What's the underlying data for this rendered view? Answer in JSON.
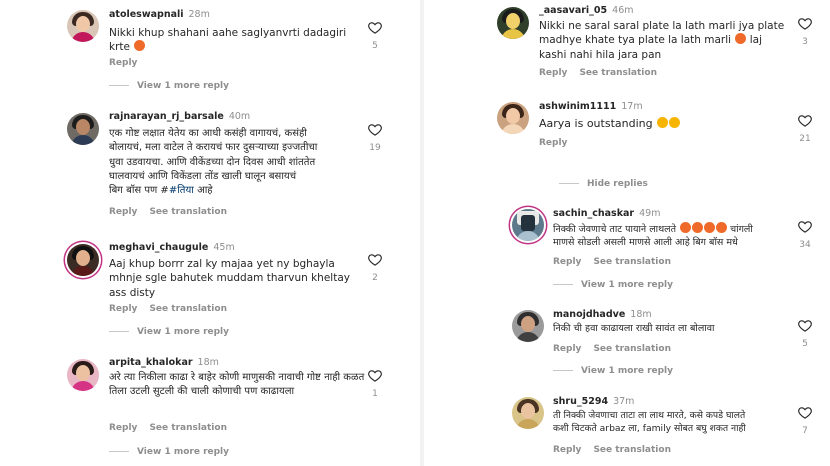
{
  "left": {
    "comments": [
      {
        "username": "atoleswapnali",
        "time": "28m",
        "text": "Nikki khup shahani aahe saglyanvrti dadagiri krte",
        "emoji": "angry",
        "reply": "Reply",
        "likes": "5",
        "view_replies": "View 1 more reply"
      },
      {
        "username": "rajnarayan_rj_barsale",
        "time": "40m",
        "text_lines": [
          "एक गोष्ट लक्षात येतेय का आधी कसंही वागायचं, कसंही",
          "बोलायचं, मला वाटेल ते करायचं फार दुसऱ्याच्या इज्जतीचा",
          "धुवा उडवायचा. आणि वीकेंडच्या दोन दिवस आधी शांततेत",
          "घालवायचं आणि विकेंडला तोंड खाली घालून बसायचं",
          "बिग बॉस पण #"
        ],
        "hashtag": "#तिया",
        "text_end": " आहे",
        "reply": "Reply",
        "translate": "See translation",
        "likes": "19"
      },
      {
        "username": "meghavi_chaugule",
        "time": "45m",
        "text": "Aaj khup borrr zal ky majaa yet ny bghayla mhnje sgle bahutek muddam tharvun kheltay ass disty",
        "reply": "Reply",
        "translate": "See translation",
        "likes": "2",
        "view_replies": "View 1 more reply"
      },
      {
        "username": "arpita_khalokar",
        "time": "18m",
        "text": "अरे त्या निकीला काढा रे बाहेर कोणी माणुसकी नावाची गोष्ट नाही कळत तिला उटली सुटली की चाली कोणाची पण काढायला",
        "reply": "Reply",
        "translate": "See translation",
        "likes": "1",
        "view_replies": "View 1 more reply"
      }
    ]
  },
  "right": {
    "comments": [
      {
        "username": "_aasavari_05",
        "time": "46m",
        "text": "Nikki ne saral saral plate la lath marli jya plate madhye khate tya plate la lath marli",
        "text_end": " laj kashi nahi hila jara pan",
        "reply": "Reply",
        "translate": "See translation",
        "likes": "3"
      },
      {
        "username": "ashwinim1111",
        "time": "17m",
        "text": "Aarya is outstanding",
        "reply": "Reply",
        "likes": "21",
        "hide_replies": "Hide replies"
      },
      {
        "username": "sachin_chaskar",
        "time": "49m",
        "text": "निक्की जेवणाचे ताट पायाने लाथलते",
        "text_mid": " चांगली",
        "text_line2": "माणसे सोडली असली माणसे आली आहे बिग बॉस मधे",
        "reply": "Reply",
        "translate": "See translation",
        "likes": "34",
        "view_replies": "View 1 more reply"
      },
      {
        "username": "manojdhadve",
        "time": "18m",
        "text": "निकी ची हवा काढायला राखी सावंत ला बोलावा",
        "reply": "Reply",
        "translate": "See translation",
        "likes": "5",
        "view_replies": "View 1 more reply"
      },
      {
        "username": "shru_5294",
        "time": "37m",
        "text_lines": [
          "ती निक्की जेवणाचा ताटा ला लाथ  मारते, कसे कपडे घालते",
          "कशी चिटकते arbaz ला, family सोबत बघु  शकत नाही"
        ],
        "reply": "Reply",
        "translate": "See translation",
        "likes": "7"
      }
    ]
  },
  "colors": {
    "text": "#262626",
    "muted": "#8e8e8e",
    "link": "#00376b",
    "divider": "#f2f2f2",
    "story_ring": "#c13584"
  }
}
